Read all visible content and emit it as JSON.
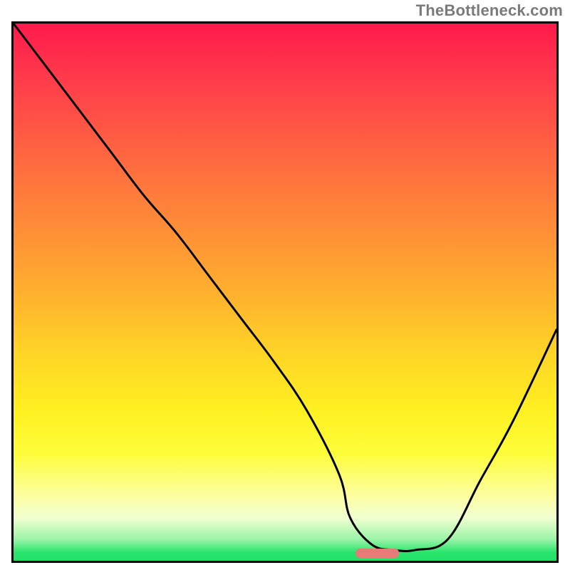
{
  "watermark": "TheBottleneck.com",
  "marker": {
    "left_pct": 62.5,
    "width_pct": 8.0,
    "y_pct": 97.8
  },
  "colors": {
    "line": "#000000",
    "marker": "#e77b78",
    "frame": "#000000"
  },
  "chart_data": {
    "type": "line",
    "title": "",
    "xlabel": "",
    "ylabel": "",
    "xlim": [
      0,
      100
    ],
    "ylim": [
      0,
      100
    ],
    "series": [
      {
        "name": "curve",
        "x": [
          0,
          6,
          12,
          18,
          24,
          30,
          36,
          42,
          48,
          54,
          60,
          62,
          66,
          70,
          74,
          80,
          86,
          92,
          100
        ],
        "y": [
          100,
          92,
          84,
          76,
          68,
          61,
          53,
          45,
          37,
          28,
          16,
          8,
          3,
          2,
          2,
          4,
          15,
          26,
          43
        ]
      }
    ]
  }
}
